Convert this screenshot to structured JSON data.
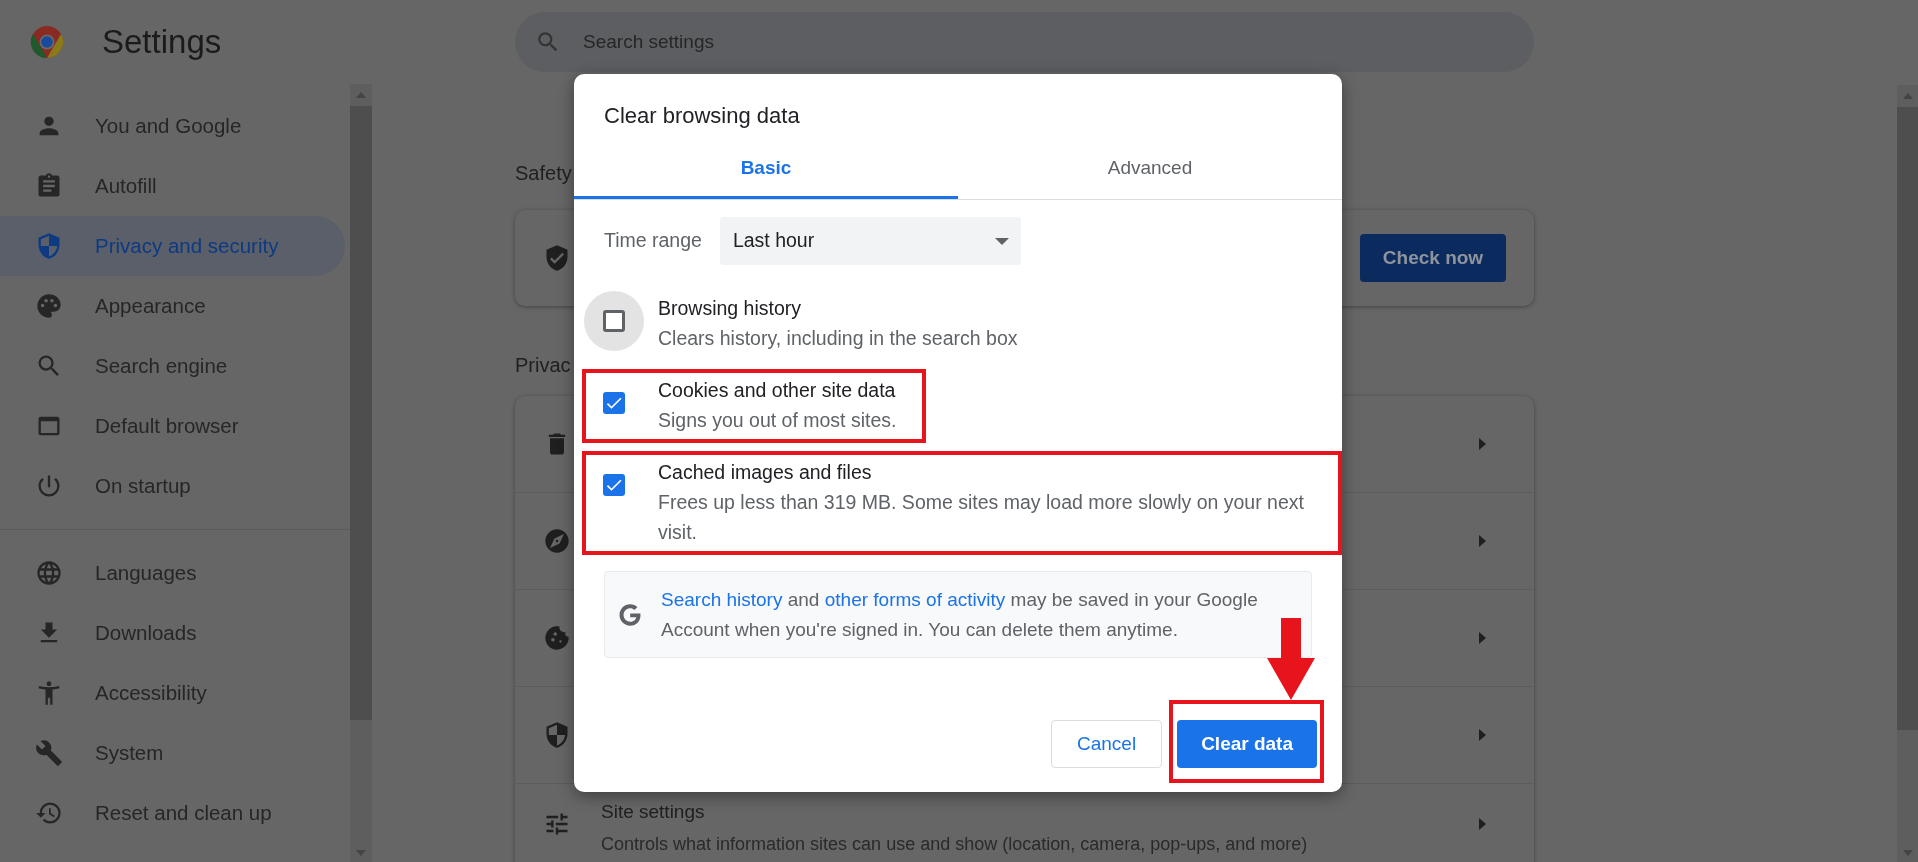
{
  "header": {
    "title": "Settings",
    "search": {
      "placeholder": "Search settings"
    }
  },
  "sidebar": {
    "groups": [
      [
        {
          "label": "You and Google",
          "selected": false
        },
        {
          "label": "Autofill",
          "selected": false
        },
        {
          "label": "Privacy and security",
          "selected": true
        },
        {
          "label": "Appearance",
          "selected": false
        },
        {
          "label": "Search engine",
          "selected": false
        },
        {
          "label": "Default browser",
          "selected": false
        },
        {
          "label": "On startup",
          "selected": false
        }
      ],
      [
        {
          "label": "Languages",
          "selected": false
        },
        {
          "label": "Downloads",
          "selected": false
        },
        {
          "label": "Accessibility",
          "selected": false
        },
        {
          "label": "System",
          "selected": false
        },
        {
          "label": "Reset and clean up",
          "selected": false
        }
      ]
    ]
  },
  "main": {
    "safety": {
      "heading": "Safety",
      "button": "Check now"
    },
    "privacy": {
      "heading": "Privac",
      "site_settings": {
        "title": "Site settings",
        "description": "Controls what information sites can use and show (location, camera, pop-ups, and more)"
      }
    }
  },
  "dialog": {
    "title": "Clear browsing data",
    "tabs": [
      {
        "label": "Basic",
        "selected": true
      },
      {
        "label": "Advanced",
        "selected": false
      }
    ],
    "time_range": {
      "label": "Time range",
      "value": "Last hour"
    },
    "options": [
      {
        "title": "Browsing history",
        "description": "Clears history, including in the search box",
        "checked": false,
        "hovered": true,
        "highlighted": false
      },
      {
        "title": "Cookies and other site data",
        "description": "Signs you out of most sites.",
        "checked": true,
        "hovered": false,
        "highlighted": true
      },
      {
        "title": "Cached images and files",
        "description": "Frees up less than 319 MB. Some sites may load more slowly on your next visit.",
        "checked": true,
        "hovered": false,
        "highlighted": true
      }
    ],
    "info": [
      {
        "text": "Search history",
        "link": true
      },
      {
        "text": " and ",
        "link": false
      },
      {
        "text": "other forms of activity",
        "link": true
      },
      {
        "text": " may be saved in your Google Account when you're signed in. You can delete them anytime.",
        "link": false
      }
    ],
    "buttons": [
      {
        "label": "Cancel",
        "kind": "secondary",
        "highlighted": false
      },
      {
        "label": "Clear data",
        "kind": "primary",
        "highlighted": true
      }
    ]
  }
}
